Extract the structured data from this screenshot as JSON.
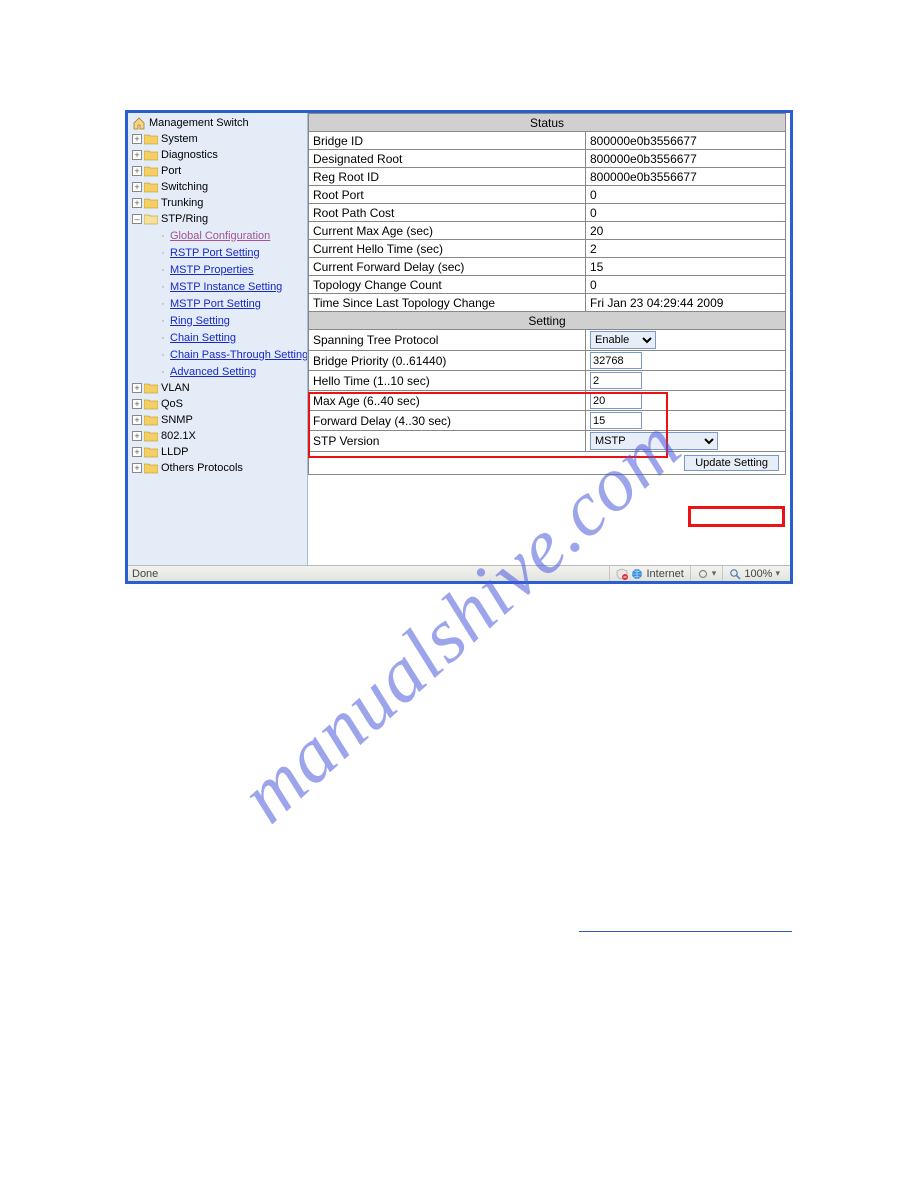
{
  "tree": {
    "root": "Management Switch",
    "items": [
      "System",
      "Diagnostics",
      "Port",
      "Switching",
      "Trunking"
    ],
    "stp": {
      "label": "STP/Ring",
      "children": [
        "Global Configuration",
        "RSTP Port Setting",
        "MSTP Properties",
        "MSTP Instance Setting",
        "MSTP Port Setting",
        "Ring Setting",
        "Chain Setting",
        "Chain Pass-Through Setting",
        "Advanced Setting"
      ]
    },
    "items2": [
      "VLAN",
      "QoS",
      "SNMP",
      "802.1X",
      "LLDP",
      "Others Protocols"
    ]
  },
  "status": {
    "header": "Status",
    "rows": [
      {
        "k": "Bridge ID",
        "v": "800000e0b3556677"
      },
      {
        "k": "Designated Root",
        "v": "800000e0b3556677"
      },
      {
        "k": "Reg Root ID",
        "v": "800000e0b3556677"
      },
      {
        "k": "Root Port",
        "v": "0"
      },
      {
        "k": "Root Path Cost",
        "v": "0"
      },
      {
        "k": "Current Max Age (sec)",
        "v": "20"
      },
      {
        "k": "Current Hello Time (sec)",
        "v": "2"
      },
      {
        "k": "Current Forward Delay (sec)",
        "v": "15"
      },
      {
        "k": "Topology Change Count",
        "v": "0"
      },
      {
        "k": "Time Since Last Topology Change",
        "v": "Fri Jan 23 04:29:44 2009"
      }
    ]
  },
  "setting": {
    "header": "Setting",
    "stp_label": "Spanning Tree Protocol",
    "stp_value": "Enable",
    "bp_label": "Bridge Priority (0..61440)",
    "bp_value": "32768",
    "ht_label": "Hello Time (1..10 sec)",
    "ht_value": "2",
    "ma_label": "Max Age (6..40 sec)",
    "ma_value": "20",
    "fd_label": "Forward Delay (4..30 sec)",
    "fd_value": "15",
    "ver_label": "STP Version",
    "ver_value": "MSTP",
    "update_btn": "Update Setting"
  },
  "statusbar": {
    "done": "Done",
    "zone": "Internet",
    "zoom": "100%"
  },
  "watermark": "manualshive.com"
}
